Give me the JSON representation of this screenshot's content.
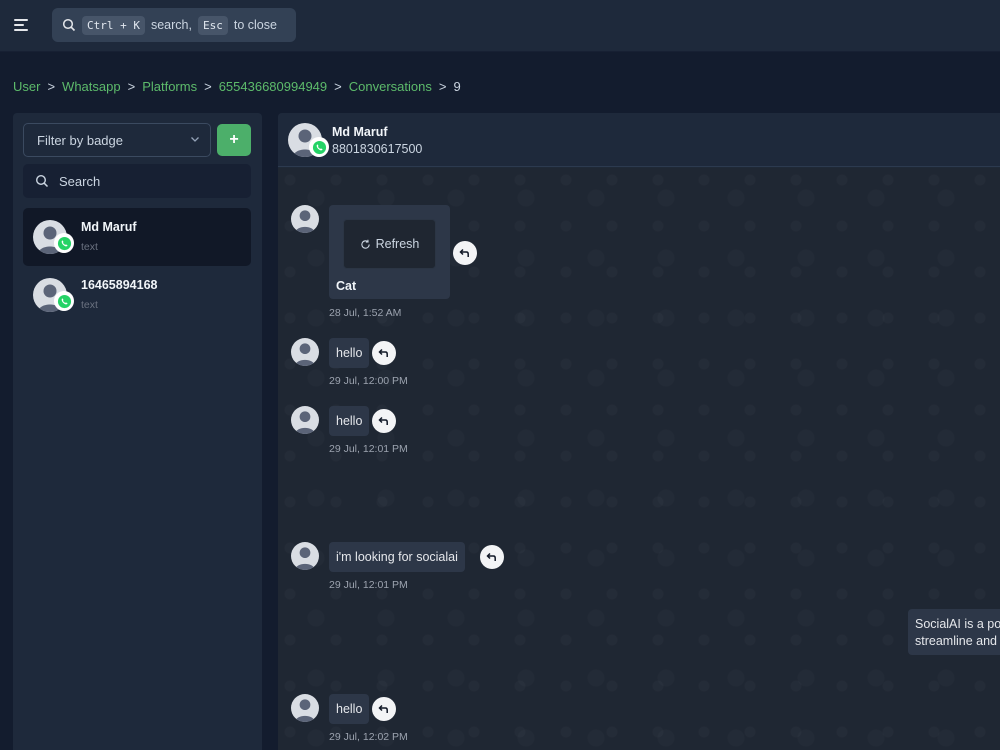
{
  "topbar": {
    "search_key1": "Ctrl + K",
    "search_text1": "search,",
    "search_key2": "Esc",
    "search_text2": "to close"
  },
  "breadcrumb": {
    "items": [
      "User",
      "Whatsapp",
      "Platforms",
      "655436680994949",
      "Conversations"
    ],
    "current": "9",
    "separator": ">"
  },
  "sidebar": {
    "filter_placeholder": "Filter by badge",
    "add_label": "+",
    "search_placeholder": "Search",
    "contacts": [
      {
        "name": "Md Maruf",
        "subtitle": "text",
        "active": true
      },
      {
        "name": "16465894168",
        "subtitle": "text",
        "active": false
      }
    ]
  },
  "chat": {
    "contact_name": "Md Maruf",
    "contact_phone": "8801830617500",
    "messages": [
      {
        "type": "media",
        "button_label": "Refresh",
        "caption": "Cat",
        "time": "28 Jul, 1:52 AM"
      },
      {
        "type": "text",
        "text": "hello",
        "time": "29 Jul, 12:00 PM"
      },
      {
        "type": "text",
        "text": "hello",
        "time": "29 Jul, 12:01 PM"
      },
      {
        "type": "text",
        "text": "i'm looking for socialai",
        "time": "29 Jul, 12:01 PM"
      },
      {
        "type": "outgoing",
        "line1": "SocialAI is a pow",
        "line2": "streamline and ."
      },
      {
        "type": "text",
        "text": "hello",
        "time": "29 Jul, 12:02 PM"
      }
    ]
  },
  "colors": {
    "accent_green": "#4caf6a",
    "link_green": "#5dbb6b",
    "whatsapp_green": "#25d366"
  }
}
